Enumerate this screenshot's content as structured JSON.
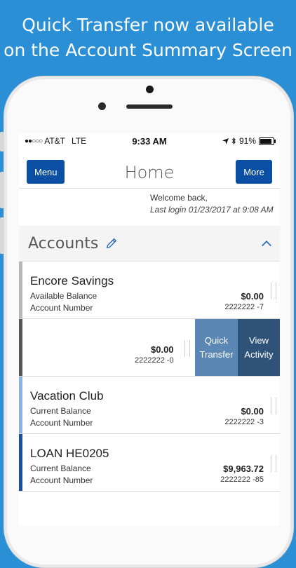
{
  "promo": {
    "line1": "Quick Transfer now available",
    "line2": "on the Account Summary Screen"
  },
  "status_bar": {
    "signal": "●●○○○",
    "carrier": "AT&T",
    "network": "LTE",
    "time": "9:33 AM",
    "battery": "91%",
    "battery_level": 0.91
  },
  "nav": {
    "menu_label": "Menu",
    "title": "Home",
    "more_label": "More"
  },
  "welcome": {
    "greeting": "Welcome back,",
    "last_login": "Last login 01/23/2017 at 9:08 AM"
  },
  "accounts_header": {
    "title": "Accounts"
  },
  "accounts": [
    {
      "name": "Encore Savings",
      "line1": "Available Balance",
      "line2": "Account Number",
      "amount": "$0.00",
      "number": "2222222 -7",
      "color": "#b8b8b8"
    },
    {
      "amount": "$0.00",
      "number": "2222222 -0",
      "color": "#555555",
      "actions": {
        "quick_transfer": "Quick Transfer",
        "view_activity": "View Activity"
      }
    },
    {
      "name": "Vacation Club",
      "line1": "Current Balance",
      "line2": "Account Number",
      "amount": "$0.00",
      "number": "2222222 -3",
      "color": "#8ab4e3"
    },
    {
      "name": "LOAN HE0205",
      "line1": "Current Balance",
      "line2": "Account Number",
      "amount": "$9,963.72",
      "number": "2222222 -85",
      "color": "#1b4f9c"
    }
  ],
  "colors": {
    "background": "#2b8fd6",
    "primary_button": "#0a4fa3",
    "quick_transfer": "#5a87b4",
    "view_activity": "#2f5279"
  }
}
